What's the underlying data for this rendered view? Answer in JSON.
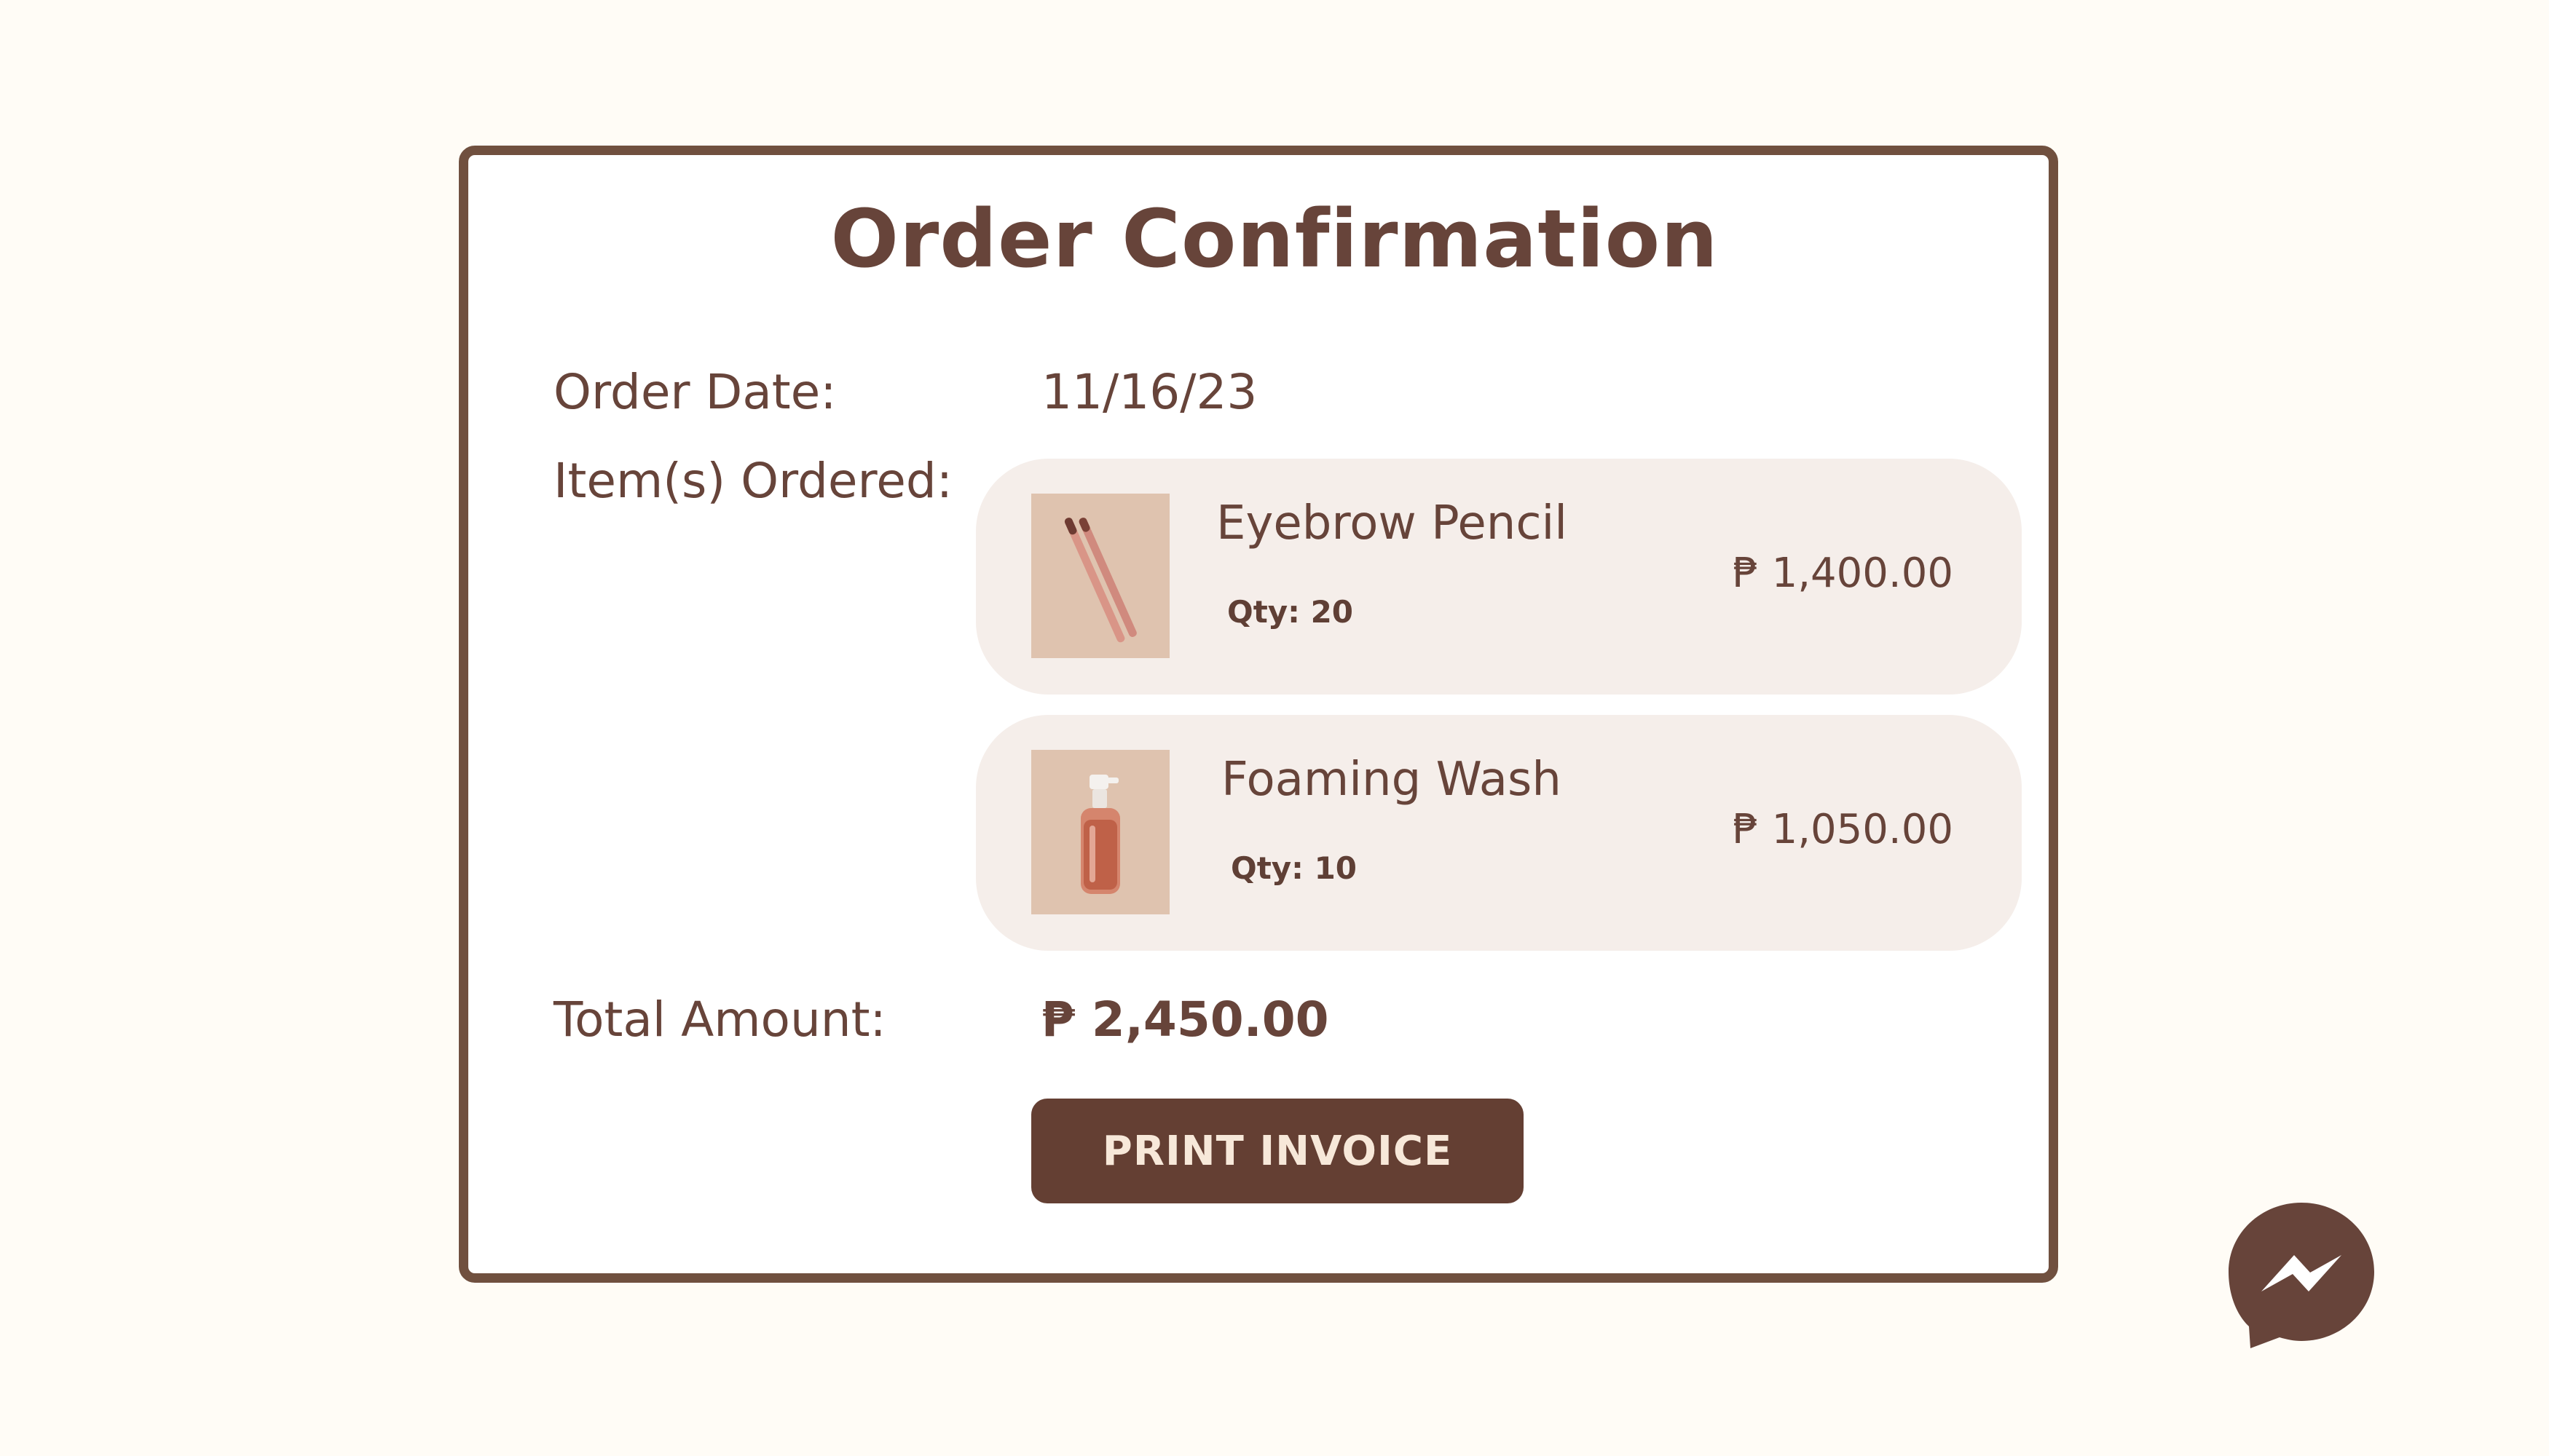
{
  "page": {
    "title": "Order Confirmation"
  },
  "order": {
    "date_label": "Order Date:",
    "date_value": "11/16/23",
    "items_label": "Item(s) Ordered:",
    "items": [
      {
        "name": "Eyebrow Pencil",
        "qty": "Qty: 20",
        "price": "₱ 1,400.00",
        "image": "eyebrow-pencil-image"
      },
      {
        "name": "Foaming Wash",
        "qty": "Qty: 10",
        "price": "₱ 1,050.00",
        "image": "foaming-wash-image"
      }
    ],
    "total_label": "Total Amount:",
    "total_value": "₱ 2,450.00"
  },
  "actions": {
    "print_label": "PRINT INVOICE"
  },
  "chat": {
    "icon": "messenger-icon"
  },
  "colors": {
    "background": "#fffcf6",
    "brown": "#67443a",
    "border": "#70503f",
    "item_bg": "#f5eeea",
    "button_bg": "#643f33",
    "button_text": "#f7e8d9"
  }
}
